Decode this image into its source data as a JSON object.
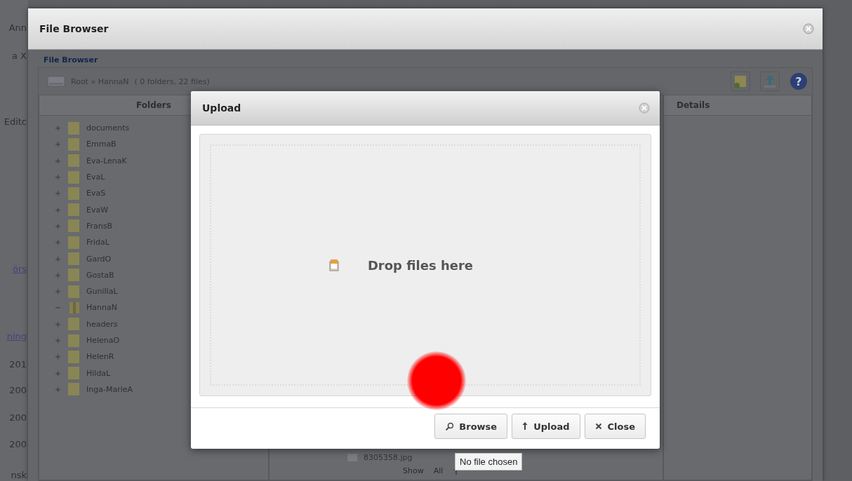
{
  "background_page": {
    "fragments": [
      "Ann",
      "a X",
      "Editc",
      "örs",
      "ning",
      "201",
      "200",
      "200",
      "200",
      "nsk"
    ]
  },
  "file_browser": {
    "title": "File Browser",
    "panel_title": "File Browser",
    "path": "Root » HannaN",
    "summary": "( 0 folders, 22 files)",
    "toolbar": [
      {
        "kind": "new-folder"
      },
      {
        "kind": "upload"
      },
      {
        "kind": "help",
        "glyph": "?"
      }
    ],
    "folders_header": "Folders",
    "folders": [
      {
        "name": "documents",
        "expanded": false
      },
      {
        "name": "EmmaB",
        "expanded": false
      },
      {
        "name": "Eva-LenaK",
        "expanded": false
      },
      {
        "name": "EvaL",
        "expanded": false
      },
      {
        "name": "EvaS",
        "expanded": false
      },
      {
        "name": "EvaW",
        "expanded": false
      },
      {
        "name": "FransB",
        "expanded": false
      },
      {
        "name": "FridaL",
        "expanded": false
      },
      {
        "name": "GardO",
        "expanded": false
      },
      {
        "name": "GostaB",
        "expanded": false
      },
      {
        "name": "GunillaL",
        "expanded": false
      },
      {
        "name": "HannaN",
        "expanded": true
      },
      {
        "name": "headers",
        "expanded": false
      },
      {
        "name": "HelenaO",
        "expanded": false
      },
      {
        "name": "HelenR",
        "expanded": false
      },
      {
        "name": "HildaL",
        "expanded": false
      },
      {
        "name": "Inga-MarieA",
        "expanded": false
      }
    ],
    "files": [
      {
        "name": "8305358.jpg"
      }
    ],
    "pager": {
      "label": "Show",
      "option": "All"
    },
    "details_header": "Details"
  },
  "upload_dialog": {
    "title": "Upload",
    "drop_hint": "Drop files here",
    "buttons": [
      {
        "kind": "browse",
        "label": "Browse"
      },
      {
        "kind": "upload",
        "label": "Upload"
      },
      {
        "kind": "close",
        "label": "Close"
      }
    ]
  },
  "tooltip": "No file chosen"
}
